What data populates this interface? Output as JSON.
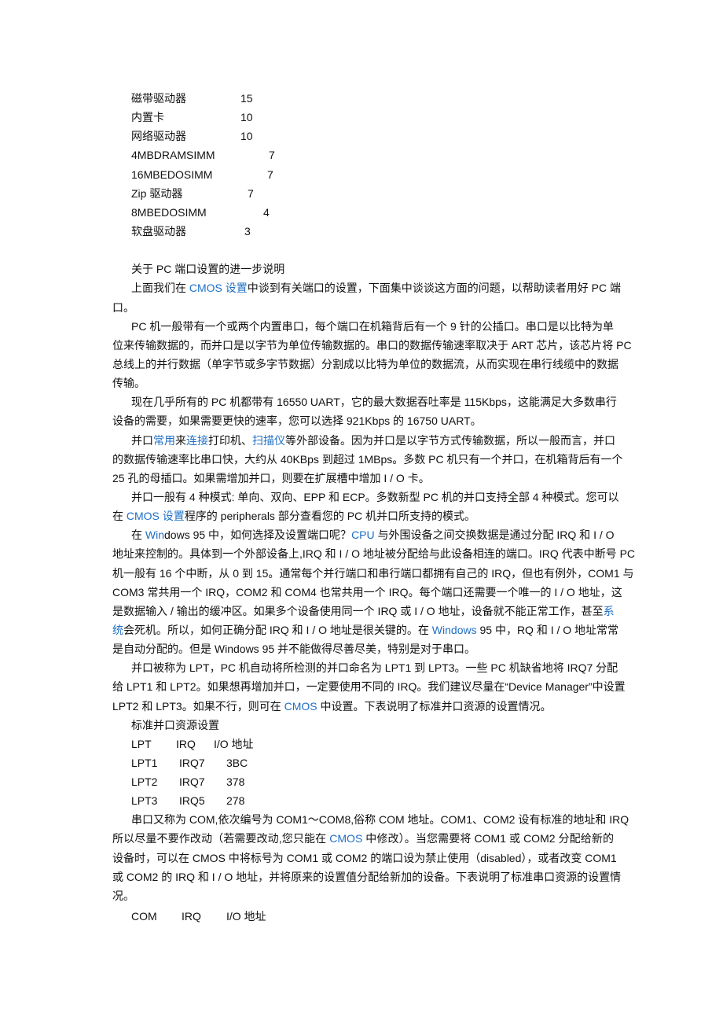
{
  "device_list": [
    {
      "name": "磁带驱动器",
      "value": "15"
    },
    {
      "name": "内置卡",
      "value": "10"
    },
    {
      "name": "网络驱动器",
      "value": "10"
    },
    {
      "name": "4MBDRAMSIMM",
      "value": "7"
    },
    {
      "name": "16MBEDOSIMM",
      "value": "7"
    },
    {
      "name": "Zip 驱动器",
      "value": "7"
    },
    {
      "name": "8MBEDOSIMM",
      "value": "4"
    },
    {
      "name": "软盘驱动器",
      "value": "3"
    }
  ],
  "section_title": "关于 PC 端口设置的进一步说明",
  "link_color": "#1f6fc5",
  "paragraphs_a": [
    [
      [
        "上面我们在 ",
        {
          "link": "CMOS 设置"
        },
        "中谈到有关端口的设置，下面集中谈谈这方面的问题，以帮助读者用好 PC 端"
      ],
      [
        "口。"
      ]
    ],
    [
      [
        "PC 机一般带有一个或两个内置串口，每个端口在机箱背后有一个 9 针的公插口。串口是以比特为单"
      ],
      [
        "位来传输数据的，而并口是以字节为单位传输数据的。串口的数据传输速率取决于 ART 芯片，该芯片将 PC"
      ],
      [
        "总线上的并行数据（单字节或多字节数据）分割成以比特为单位的数据流，从而实现在串行线缆中的数据"
      ],
      [
        "传输。"
      ]
    ],
    [
      [
        "现在几乎所有的 PC 机都带有 16550 UART，它的最大数据吞吐率是 115Kbps，这能满足大多数串行"
      ],
      [
        "设备的需要，如果需要更快的速率，您可以选择 921Kbps  的 16750 UART。"
      ]
    ],
    [
      [
        "并口",
        {
          "link": "常用"
        },
        "来",
        {
          "link": "连接"
        },
        "打印机、",
        {
          "link": "扫描仪"
        },
        "等外部设备。因为并口是以字节方式传输数据，所以一般而言，并口"
      ],
      [
        "的数据传输速率比串口快，大约从 40KBps 到超过 1MBps。多数 PC 机只有一个并口，在机箱背后有一个"
      ],
      [
        "25 孔的母插口。如果需增加并口，则要在扩展槽中增加 I / O 卡。"
      ]
    ],
    [
      [
        "并口一般有 4 种模式: 单向、双向、EPP 和 ECP。多数新型 PC 机的并口支持全部 4 种模式。您可以"
      ],
      [
        "在 ",
        {
          "link": "CMOS 设置"
        },
        "程序的 peripherals 部分查看您的 PC 机并口所支持的模式。"
      ]
    ],
    [
      [
        "在 ",
        {
          "link": "Win"
        },
        "dows 95 中，如何选择及设置端口呢？",
        {
          "link": "CPU"
        },
        " 与外围设备之间交换数据是通过分配 IRQ 和 I / O"
      ],
      [
        "地址来控制的。具体到一个外部设备上,IRQ 和 I / O 地址被分配给与此设备相连的端口。IRQ 代表中断号 PC"
      ],
      [
        "机一般有 16 个中断，从 0 到 15。通常每个并行端口和串行端口都拥有自己的 IRQ，但也有例外，COM1 与"
      ],
      [
        "COM3 常共用一个 IRQ，COM2 和 COM4 也常共用一个 IRQ。每个端口还需要一个唯一的 I / O 地址，这"
      ],
      [
        "是数据输入 / 输出的缓冲区。如果多个设备使用同一个 IRQ 或 I / O 地址，设备就不能正常工作，甚至",
        {
          "link": "系"
        }
      ],
      [
        {
          "link": "统"
        },
        "会死机。所以，如何正确分配 IRQ 和 I / O 地址是很关键的。在 ",
        {
          "link": "Windows"
        },
        " 95 中，RQ 和 I / O 地址常常"
      ],
      [
        "是自动分配的。但是 Windows 95 并不能做得尽善尽美，特别是对于串口。"
      ]
    ],
    [
      [
        "并口被称为 LPT，PC 机自动将所检测的并口命名为 LPT1 到 LPT3。一些 PC 机缺省地将 IRQ7 分配"
      ],
      [
        "给 LPT1 和 LPT2。如果想再增加并口，一定要使用不同的 IRQ。我们建议尽量在“Device Manager”中设置"
      ],
      [
        "LPT2 和 LPT3。如果不行，则可在 ",
        {
          "link": "CMOS"
        },
        " 中设置。下表说明了标准并口资源的设置情况。"
      ]
    ]
  ],
  "lpt_table": {
    "caption": "标准并口资源设置",
    "headers": [
      "LPT",
      "IRQ",
      "I/O 地址"
    ],
    "rows": [
      [
        "LPT1",
        "IRQ7",
        "3BC"
      ],
      [
        "LPT2",
        "IRQ7",
        "378"
      ],
      [
        "LPT3",
        "IRQ5",
        "278"
      ]
    ]
  },
  "paragraphs_b": [
    [
      [
        "串口又称为 COM,依次编号为 COM1～COM8,俗称 COM 地址。COM1、COM2 设有标准的地址和 IRQ"
      ],
      [
        "所以尽量不要作改动（若需要改动,您只能在 ",
        {
          "link": "CMOS"
        },
        " 中修改）。当您需要将 COM1 或 COM2 分配给新的"
      ],
      [
        "设备时，可以在 CMOS 中将标号为 COM1 或 COM2 的端口设为禁止使用（disabled），或者改变 COM1"
      ],
      [
        "或 COM2 的 IRQ 和 I / O 地址，并将原来的设置值分配给新加的设备。下表说明了标准串口资源的设置情"
      ],
      [
        "况。"
      ]
    ]
  ],
  "com_table": {
    "headers": [
      "COM",
      "IRQ",
      "I/O 地址"
    ]
  }
}
